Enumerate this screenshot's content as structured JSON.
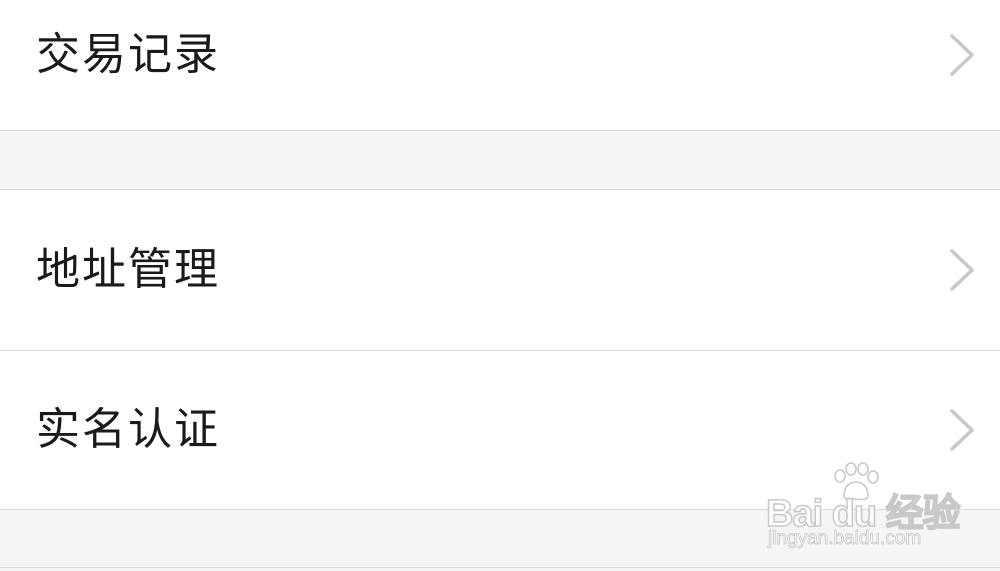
{
  "menu": {
    "items": [
      {
        "label": "交易记录"
      },
      {
        "label": "地址管理"
      },
      {
        "label": "实名认证"
      }
    ]
  },
  "watermark": {
    "brand": "Bai du 经验",
    "url": "jingyan.baidu.com"
  },
  "colors": {
    "background": "#f5f5f5",
    "card": "#ffffff",
    "divider": "#dcdcdc",
    "text": "#1a1a1a",
    "chevron": "#c7c7cc"
  }
}
